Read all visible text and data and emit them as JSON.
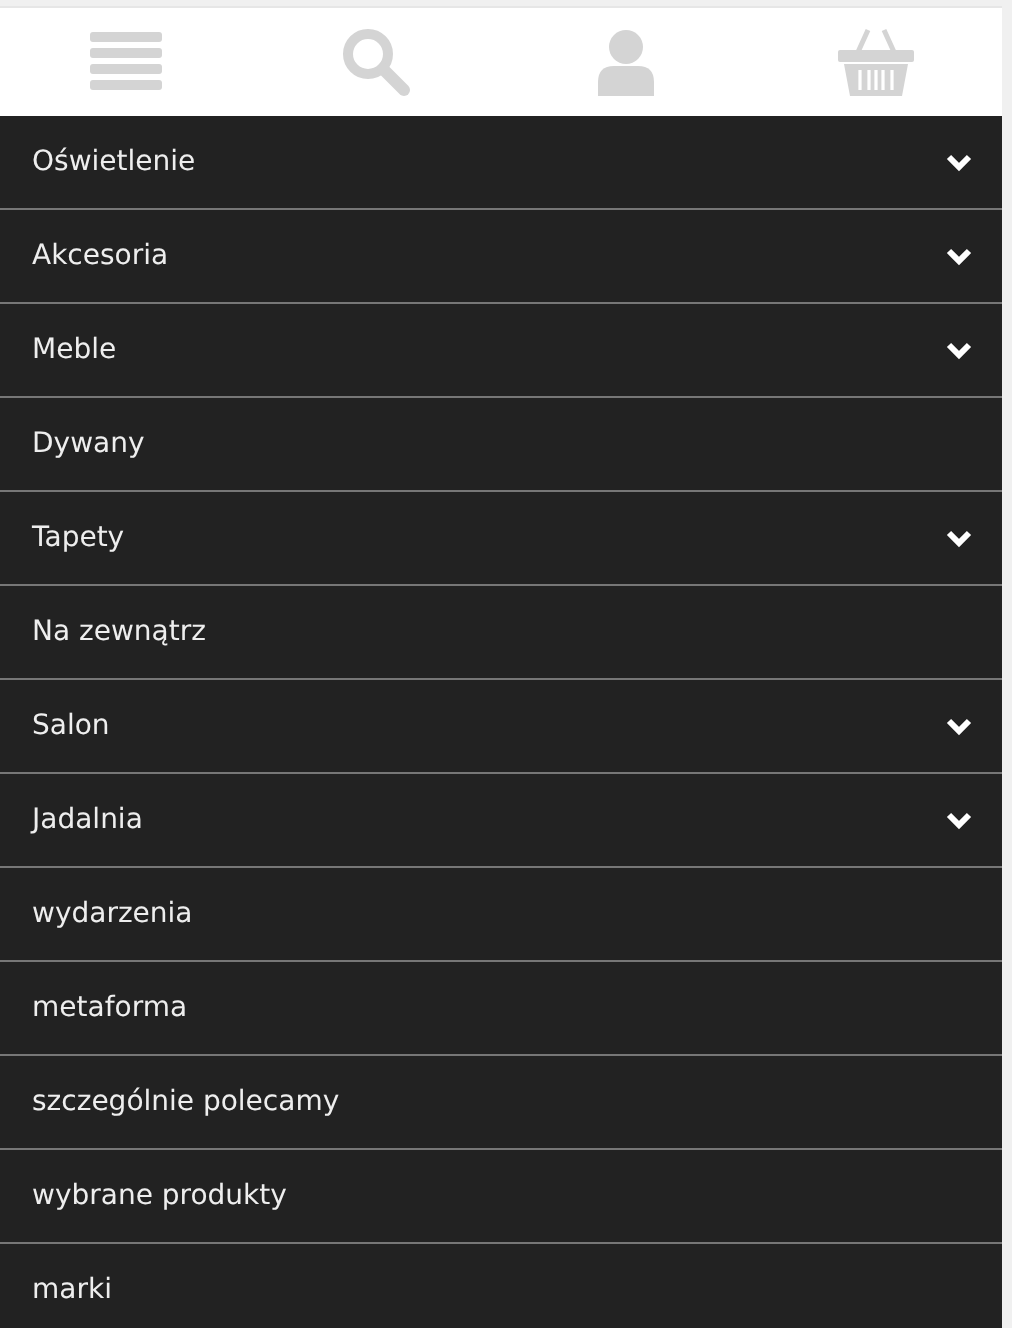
{
  "menu": [
    {
      "label": "Oświetlenie",
      "has_submenu": true
    },
    {
      "label": "Akcesoria",
      "has_submenu": true
    },
    {
      "label": "Meble",
      "has_submenu": true
    },
    {
      "label": "Dywany",
      "has_submenu": false
    },
    {
      "label": "Tapety",
      "has_submenu": true
    },
    {
      "label": "Na zewnątrz",
      "has_submenu": false
    },
    {
      "label": "Salon",
      "has_submenu": true
    },
    {
      "label": "Jadalnia",
      "has_submenu": true
    },
    {
      "label": "wydarzenia",
      "has_submenu": false
    },
    {
      "label": "metaforma",
      "has_submenu": false
    },
    {
      "label": "szczególnie polecamy",
      "has_submenu": false
    },
    {
      "label": "wybrane produkty",
      "has_submenu": false
    },
    {
      "label": "marki",
      "has_submenu": false
    }
  ]
}
